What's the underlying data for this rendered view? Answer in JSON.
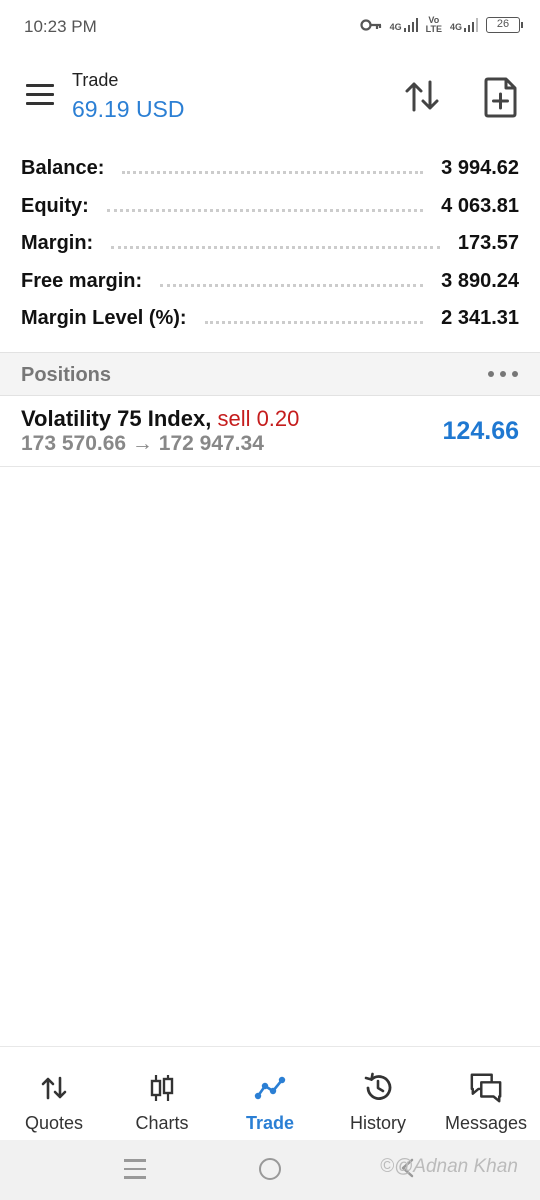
{
  "status_bar": {
    "time": "10:23 PM",
    "net1": "4G",
    "volte_top": "Vo",
    "volte_bottom": "LTE",
    "net2": "4G",
    "battery": "26"
  },
  "header": {
    "title": "Trade",
    "subtitle": "69.19 USD"
  },
  "summary": [
    {
      "label": "Balance:",
      "value": "3 994.62"
    },
    {
      "label": "Equity:",
      "value": "4 063.81"
    },
    {
      "label": "Margin:",
      "value": "173.57"
    },
    {
      "label": "Free margin:",
      "value": "3 890.24"
    },
    {
      "label": "Margin Level (%):",
      "value": "2 341.31"
    }
  ],
  "positions": {
    "title": "Positions",
    "items": [
      {
        "symbol": "Volatility 75 Index,",
        "side": "sell 0.20",
        "prices": "173 570.66 → 172 947.34",
        "profit": "124.66"
      }
    ]
  },
  "bottom_nav": [
    {
      "label": "Quotes",
      "icon": "quotes-arrows-icon"
    },
    {
      "label": "Charts",
      "icon": "candlestick-icon"
    },
    {
      "label": "Trade",
      "icon": "trade-line-icon",
      "active": true
    },
    {
      "label": "History",
      "icon": "history-clock-icon"
    },
    {
      "label": "Messages",
      "icon": "messages-bubbles-icon"
    }
  ],
  "watermark": "©@Adnan Khan",
  "colors": {
    "accent": "#2b7fd4",
    "sell": "#c51d1d",
    "profit": "#1f78d1"
  }
}
